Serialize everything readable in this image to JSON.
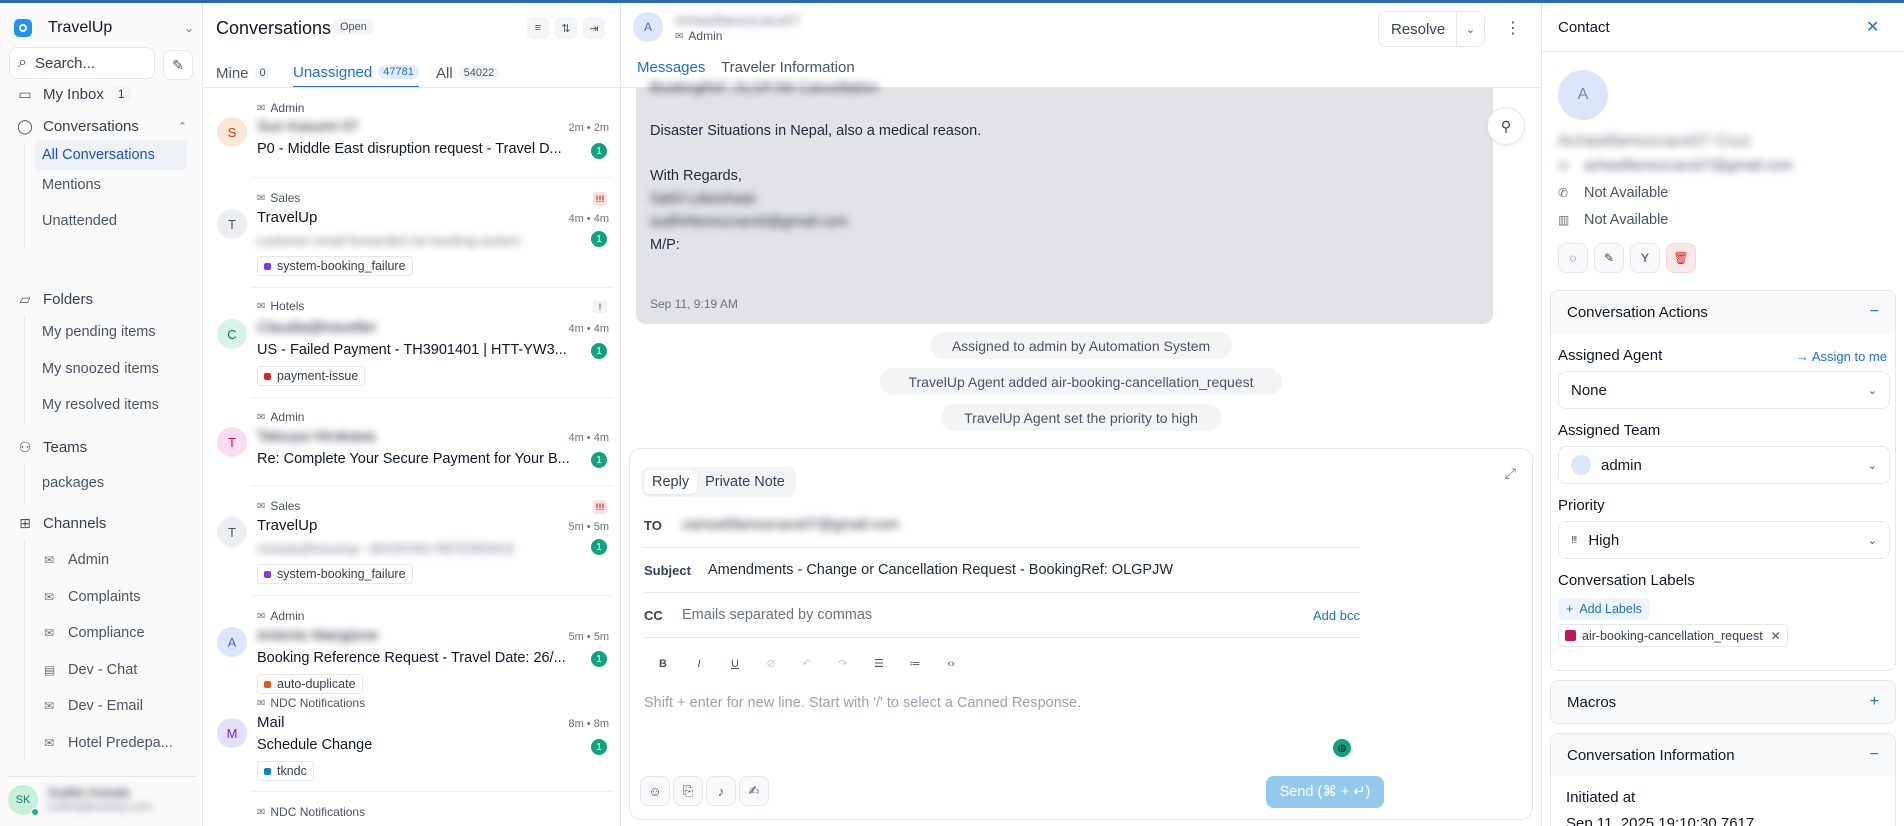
{
  "brand": {
    "name": "TravelUp"
  },
  "sidebar": {
    "search_label": "Search...",
    "my_inbox": {
      "label": "My Inbox",
      "count": "1"
    },
    "conversations_label": "Conversations",
    "conversation_items": [
      "All Conversations",
      "Mentions",
      "Unattended"
    ],
    "folders_label": "Folders",
    "folder_items": [
      "My pending items",
      "My snoozed items",
      "My resolved items"
    ],
    "teams_label": "Teams",
    "team_items": [
      "packages"
    ],
    "channels_label": "Channels",
    "channel_items": [
      "Admin",
      "Complaints",
      "Compliance",
      "Dev - Chat",
      "Dev - Email",
      "Hotel Predepa..."
    ],
    "user": {
      "name": "Sudhir Koirala",
      "email": "sudhir@travelup.com",
      "initials": "SK"
    }
  },
  "conv_list": {
    "title": "Conversations",
    "status": "Open",
    "tabs": [
      {
        "label": "Mine",
        "count": "0"
      },
      {
        "label": "Unassigned",
        "count": "47781"
      },
      {
        "label": "All",
        "count": "54022"
      }
    ],
    "items": [
      {
        "inbox": "Admin",
        "name": "Sun Kasumi 07",
        "time": "2m • 2m",
        "subject": "P0 - Middle East disruption request - Travel D...",
        "unread": "1",
        "initial": "S"
      },
      {
        "inbox": "Sales",
        "name": "TravelUp",
        "time": "4m • 4m",
        "preview": "customer email forwarded via booking system",
        "label": "system-booking_failure",
        "unread": "1",
        "initial": "T",
        "priority": "!!!"
      },
      {
        "inbox": "Hotels",
        "name": "Claudia@traveller",
        "time": "4m • 4m",
        "subject": "US - Failed Payment - TH3901401 | HTT-YW3...",
        "label": "payment-issue",
        "unread": "1",
        "initial": "C",
        "priority": "!"
      },
      {
        "inbox": "Admin",
        "name": "Tatsuya Hirokawa",
        "time": "4m • 4m",
        "subject": "Re: Complete Your Secure Payment for Your B...",
        "unread": "1",
        "initial": "T"
      },
      {
        "inbox": "Sales",
        "name": "TravelUp",
        "time": "5m • 5m",
        "preview": "noreply@travelup - BOOKING REFERENCE",
        "label": "system-booking_failure",
        "unread": "1",
        "initial": "T",
        "priority": "!!!"
      },
      {
        "inbox": "Admin",
        "name": "Antonio Mangione",
        "time": "5m • 5m",
        "subject": "Booking Reference Request - Travel Date: 26/...",
        "label": "auto-duplicate",
        "unread": "1",
        "initial": "A"
      },
      {
        "inbox": "NDC Notifications",
        "name": "Mail",
        "time": "8m • 8m",
        "subject": "Schedule Change",
        "label": "tkndc",
        "unread": "1",
        "initial": "M"
      },
      {
        "inbox": "NDC Notifications"
      }
    ]
  },
  "main": {
    "contact_name": "Achastfamozcavs07",
    "contact_initial": "A",
    "inbox": "Admin",
    "resolve_label": "Resolve",
    "tabs": [
      "Messages",
      "Traveler Information"
    ],
    "message": {
      "top_line": "BookingRef: OLGPJW Cancellation",
      "line1": "Disaster Situations in Nepal, also a medical reason.",
      "regards": "With Regards,",
      "sig_name": "Sahil Lokeshwar",
      "sig_email": "sudhirfamozcavs0@gmail.com",
      "mp": "M/P:",
      "time": "Sep 11, 9:19 AM"
    },
    "activities": [
      "Assigned to admin by Automation System",
      "TravelUp Agent added air-booking-cancellation_request",
      "TravelUp Agent set the priority to high"
    ],
    "editor": {
      "tabs": [
        "Reply",
        "Private Note"
      ],
      "to_label": "TO",
      "to_value": "camsa5famozcavs07@gmail.com",
      "subject_label": "Subject",
      "subject_value": "Amendments - Change or Cancellation Request - BookingRef: OLGPJW",
      "cc_label": "CC",
      "cc_placeholder": "Emails separated by commas",
      "add_bcc": "Add bcc",
      "placeholder": "Shift + enter for new line. Start with '/' to select a Canned Response.",
      "send_label": "Send (⌘ + ↵)"
    }
  },
  "contact": {
    "header": "Contact",
    "name": "Achastfamozcavs07 Cruz",
    "email": "achastfamozcavs07@gmail.com",
    "phone": "Not Available",
    "company": "Not Available",
    "actions_title": "Conversation Actions",
    "assigned_agent_label": "Assigned Agent",
    "assign_to_me": "Assign to me",
    "assigned_agent_value": "None",
    "assigned_team_label": "Assigned Team",
    "assigned_team_value": "admin",
    "priority_label": "Priority",
    "priority_value": "High",
    "labels_label": "Conversation Labels",
    "add_labels": "Add Labels",
    "labels": [
      "air-booking-cancellation_request"
    ],
    "macros_title": "Macros",
    "info_title": "Conversation Information",
    "initiated_label": "Initiated at",
    "initiated_value": "Sep 11, 2025 19:10:30.7617"
  },
  "colors": {
    "accent": "#1f6fd1",
    "unread_badge": "#10a37f",
    "send_button": "#93c9ec",
    "label_system_booking": "#7c3aed",
    "label_payment": "#dc2626",
    "label_duplicate": "#ea580c",
    "label_tkndc": "#0284c7",
    "label_air_cancel": "#be185d"
  }
}
